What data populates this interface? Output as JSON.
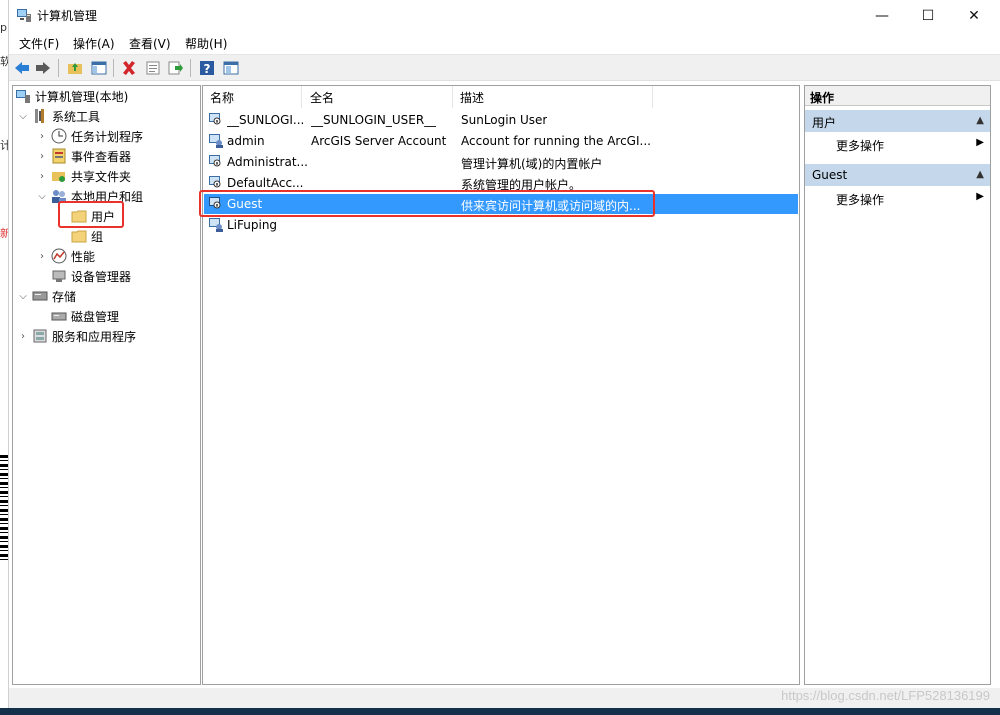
{
  "left_artifacts": [
    "p",
    "软",
    "计",
    "新"
  ],
  "window": {
    "title": "计算机管理"
  },
  "window_buttons": {
    "minimize": "—",
    "maximize": "☐",
    "close": "✕"
  },
  "menu": [
    {
      "label": "文件(F)"
    },
    {
      "label": "操作(A)"
    },
    {
      "label": "查看(V)"
    },
    {
      "label": "帮助(H)"
    }
  ],
  "toolbar_icons": [
    "back-icon",
    "forward-icon",
    "up-folder-icon",
    "show-tree-icon",
    "delete-icon",
    "properties-icon",
    "export-icon",
    "help-icon",
    "show-action-pane-icon"
  ],
  "tree": [
    {
      "label": "计算机管理(本地)",
      "icon": "computer-management-icon",
      "level": 0,
      "arrow": ""
    },
    {
      "label": "系统工具",
      "icon": "system-tools-icon",
      "level": 1,
      "arrow": "expanded"
    },
    {
      "label": "任务计划程序",
      "icon": "task-scheduler-icon",
      "level": 2,
      "arrow": "collapsed"
    },
    {
      "label": "事件查看器",
      "icon": "event-viewer-icon",
      "level": 2,
      "arrow": "collapsed"
    },
    {
      "label": "共享文件夹",
      "icon": "shared-folders-icon",
      "level": 2,
      "arrow": "collapsed"
    },
    {
      "label": "本地用户和组",
      "icon": "local-users-groups-icon",
      "level": 2,
      "arrow": "expanded"
    },
    {
      "label": "用户",
      "icon": "folder-icon",
      "level": 3,
      "arrow": ""
    },
    {
      "label": "组",
      "icon": "folder-icon",
      "level": 3,
      "arrow": ""
    },
    {
      "label": "性能",
      "icon": "performance-icon",
      "level": 2,
      "arrow": "collapsed"
    },
    {
      "label": "设备管理器",
      "icon": "device-manager-icon",
      "level": 2,
      "arrow": ""
    },
    {
      "label": "存储",
      "icon": "storage-icon",
      "level": 1,
      "arrow": "expanded"
    },
    {
      "label": "磁盘管理",
      "icon": "disk-management-icon",
      "level": 2,
      "arrow": ""
    },
    {
      "label": "服务和应用程序",
      "icon": "services-apps-icon",
      "level": 1,
      "arrow": "collapsed"
    }
  ],
  "list": {
    "columns": [
      "名称",
      "全名",
      "描述"
    ],
    "rows": [
      {
        "name": "__SUNLOGI...",
        "fullname": "__SUNLOGIN_USER__",
        "desc": "SunLogin User",
        "disabled": true
      },
      {
        "name": "admin",
        "fullname": "ArcGIS Server Account",
        "desc": "Account for running the ArcGI...",
        "disabled": false
      },
      {
        "name": "Administrat...",
        "fullname": "",
        "desc": "管理计算机(域)的内置帐户",
        "disabled": true
      },
      {
        "name": "DefaultAcc...",
        "fullname": "",
        "desc": "系统管理的用户帐户。",
        "disabled": true
      },
      {
        "name": "Guest",
        "fullname": "",
        "desc": "供来宾访问计算机或访问域的内...",
        "disabled": true,
        "selected": true
      },
      {
        "name": "LiFuping",
        "fullname": "",
        "desc": "",
        "disabled": false
      }
    ]
  },
  "actions": {
    "header": "操作",
    "sections": [
      {
        "title": "用户",
        "items": [
          "更多操作"
        ]
      },
      {
        "title": "Guest",
        "items": [
          "更多操作"
        ]
      }
    ]
  },
  "watermark": "https://blog.csdn.net/LFP528136199",
  "colors": {
    "selection": "#3399ff",
    "highlight_box": "#e8322b",
    "action_section": "#c5d7ea"
  }
}
